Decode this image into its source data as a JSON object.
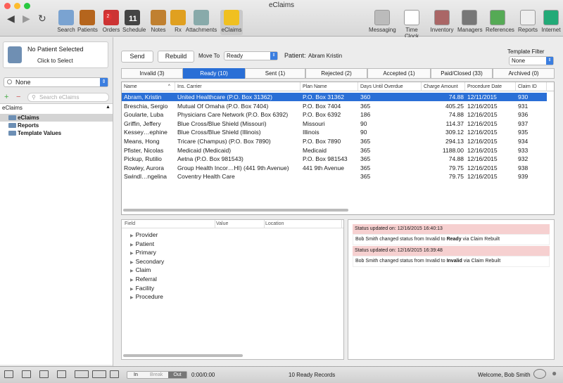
{
  "window": {
    "title": "eClaims"
  },
  "toolbar": {
    "left": [
      "Search",
      "Patients",
      "Orders",
      "Schedule",
      "Notes",
      "Rx",
      "Attachments",
      "eClaims"
    ],
    "right": [
      "Messaging",
      "Time Clock",
      "Inventory",
      "Managers",
      "References",
      "Reports",
      "Internet"
    ],
    "orders_badge": "2",
    "schedule_day": "11"
  },
  "sidebar": {
    "no_patient": "No Patient Selected",
    "click_select": "Click to Select",
    "filter": "None",
    "search_placeholder": "Search eClaims",
    "root": "eClaims",
    "items": [
      "eClaims",
      "Reports",
      "Template Values"
    ]
  },
  "actions": {
    "send": "Send",
    "rebuild": "Rebuild",
    "move_to": "Move To",
    "move_value": "Ready",
    "patient_label": "Patient:",
    "patient_name": "Abram Kristin",
    "template_filter_label": "Template Filter",
    "template_filter_value": "None"
  },
  "tabs": [
    "Invalid (3)",
    "Ready (10)",
    "Sent (1)",
    "Rejected (2)",
    "Accepted (1)",
    "Paid/Closed (33)",
    "Archived (0)"
  ],
  "table": {
    "headers": [
      "Name",
      "Ins. Carrier",
      "Plan Name",
      "Days Until Overdue",
      "Charge Amount",
      "Procedure Date",
      "Claim ID"
    ],
    "rows": [
      [
        "Abram, Kristin",
        "United Healthcare (P.O. Box 31362)",
        "P.O. Box 31362",
        "360",
        "74.88",
        "12/11/2015",
        "930"
      ],
      [
        "Breschia, Sergio",
        "Mutual Of Omaha (P.O. Box 7404)",
        "P.O. Box 7404",
        "365",
        "405.25",
        "12/16/2015",
        "931"
      ],
      [
        "Goularte, Luba",
        "Physicians Care Network (P.O. Box 6392)",
        "P.O. Box 6392",
        "186",
        "74.88",
        "12/16/2015",
        "936"
      ],
      [
        "Griffin, Jeffery",
        "Blue Cross/Blue Shield (Missouri)",
        "Missouri",
        "90",
        "114.37",
        "12/16/2015",
        "937"
      ],
      [
        "Kessey…ephine",
        "Blue Cross/Blue Shield (Illinois)",
        "Illinois",
        "90",
        "309.12",
        "12/16/2015",
        "935"
      ],
      [
        "Means, Hong",
        "Tricare (Champus) (P.O. Box 7890)",
        "P.O. Box 7890",
        "365",
        "294.13",
        "12/16/2015",
        "934"
      ],
      [
        "Pfister, Nicolas",
        "Medicaid (Medicaid)",
        "Medicaid",
        "365",
        "1188.00",
        "12/16/2015",
        "933"
      ],
      [
        "Pickup, Rutilio",
        "Aetna (P.O. Box 981543)",
        "P.O. Box 981543",
        "365",
        "74.88",
        "12/16/2015",
        "932"
      ],
      [
        "Rowley, Aurora",
        "Group Health Incor…HI) (441 9th Avenue)",
        "441 9th Avenue",
        "365",
        "79.75",
        "12/16/2015",
        "938"
      ],
      [
        "Swindl…ngelina",
        "Coventry Health Care",
        "",
        "365",
        "79.75",
        "12/16/2015",
        "939"
      ]
    ]
  },
  "fields": {
    "headers": [
      "Field",
      "Value",
      "Location"
    ],
    "items": [
      "Provider",
      "Patient",
      "Primary",
      "Secondary",
      "Claim",
      "Referral",
      "Facility",
      "Procedure"
    ]
  },
  "log": [
    {
      "header": "Status updated on: 12/16/2015 16:40:13",
      "pre": "Bob Smith changed status from Invalid to ",
      "bold": "Ready",
      "post": " via Claim Rebuilt"
    },
    {
      "header": "Status updated on: 12/16/2015 16:39:48",
      "pre": "Bob Smith changed status from Invalid to ",
      "bold": "Invalid",
      "post": " via Claim Rebuilt"
    }
  ],
  "status": {
    "in": "In",
    "break": "Break",
    "out": "Out",
    "time": "0:00/0:00",
    "records": "10 Ready Records",
    "welcome": "Welcome, Bob Smith"
  },
  "colors": {
    "selection": "#2a6fd6",
    "log_header": "#f6d0d0"
  }
}
